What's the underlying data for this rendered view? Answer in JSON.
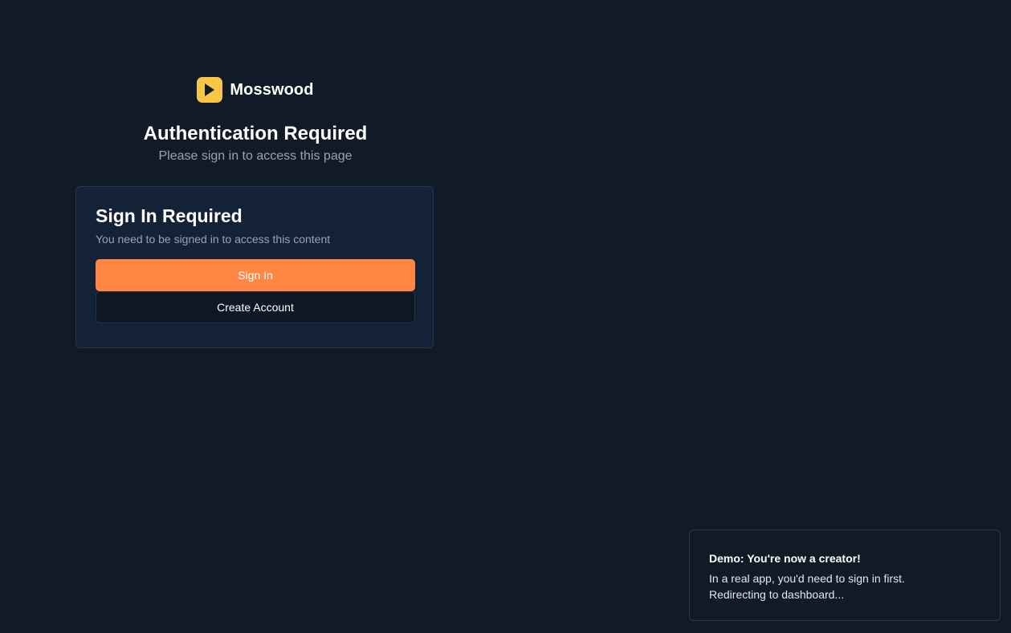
{
  "brand": {
    "name": "Mosswood",
    "logo_icon": "play-icon",
    "logo_color": "#f6c744"
  },
  "header": {
    "title": "Authentication Required",
    "subtitle": "Please sign in to access this page"
  },
  "card": {
    "title": "Sign In Required",
    "description": "You need to be signed in to access this content",
    "sign_in_label": "Sign In",
    "create_account_label": "Create Account"
  },
  "toast": {
    "title": "Demo: You're now a creator!",
    "line1": "In a real app, you'd need to sign in first.",
    "line2": "Redirecting to dashboard..."
  },
  "colors": {
    "background": "#111a27",
    "card": "#142238",
    "accent": "#ff8743",
    "brand": "#f6c744"
  }
}
